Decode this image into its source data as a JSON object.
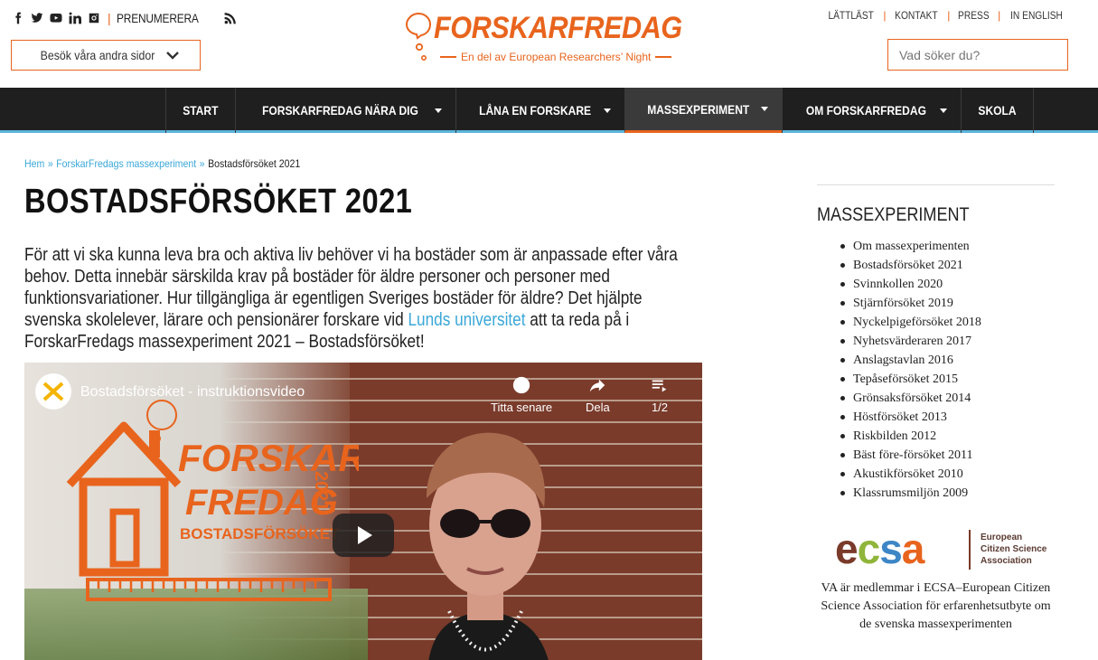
{
  "header": {
    "subscribe_label": "PRENUMERERA",
    "visit_label": "Besök våra andra sidor",
    "logo_word": "FORSKARFREDAG",
    "logo_tagline": "En del av European Researchers’ Night",
    "links": [
      "LÄTTLÄST",
      "KONTAKT",
      "PRESS",
      "IN ENGLISH"
    ],
    "search_placeholder": "Vad söker du?",
    "social_icons": [
      "facebook-icon",
      "twitter-icon",
      "youtube-icon",
      "linkedin-icon",
      "instagram-icon"
    ],
    "accent_color": "#e8641d"
  },
  "nav": {
    "items": [
      {
        "label": "START",
        "dropdown": false
      },
      {
        "label": "FORSKARFREDAG NÄRA DIG",
        "dropdown": true
      },
      {
        "label": "LÅNA EN FORSKARE",
        "dropdown": true
      },
      {
        "label": "MASSEXPERIMENT",
        "dropdown": true,
        "active": true
      },
      {
        "label": "OM FORSKARFREDAG",
        "dropdown": true
      },
      {
        "label": "SKOLA",
        "dropdown": false
      }
    ],
    "active_color": "#e8641d",
    "underline_color": "#5ab4dc"
  },
  "breadcrumb": {
    "home": "Hem",
    "sep": "»",
    "parent": "ForskarFredags massexperiment",
    "current": "Bostadsförsöket 2021"
  },
  "main": {
    "title": "BOSTADSFÖRSÖKET 2021",
    "intro_lines": [
      "För att vi ska kunna leva bra och aktiva liv behöver vi ha bostäder som är anpassade efter våra",
      "behov. Detta innebär särskilda krav på bostäder för äldre personer och personer med",
      "funktionsvariationer. Hur tillgängliga är egentligen Sveriges bostäder för äldre? Det hjälpte"
    ],
    "intro_line4_before": "svenska skolelever, lärare och pensionärer forskare vid ",
    "intro_link": "Lunds universitet",
    "intro_line4_after": " att ta reda på i",
    "intro_line5": "ForskarFredags massexperiment 2021 – Bostadsförsöket!"
  },
  "video": {
    "title": "Bostadsförsöket - instruktionsvideo",
    "watch_later": "Titta senare",
    "share": "Dela",
    "playlist": "1/2",
    "poster_line1": "FORSKAR",
    "poster_line2": "FREDAG",
    "poster_year": "2021",
    "poster_sub": "BOSTADSFÖRSÖKET"
  },
  "sidebar": {
    "heading": "MASSEXPERIMENT",
    "items": [
      "Om massexperimenten",
      "Bostadsförsöket 2021",
      "Svinnkollen 2020",
      "Stjärnförsöket 2019",
      "Nyckelpigeförsöket 2018",
      "Nyhetsvärderaren 2017",
      "Anslagstavlan 2016",
      "Tepåseförsöket 2015",
      "Grönsaksförsöket 2014",
      "Höstförsöket 2013",
      "Riskbilden 2012",
      "Bäst före-försöket 2011",
      "Akustikförsöket 2010",
      "Klassrumsmiljön 2009"
    ],
    "ecsa_logo_text": "ecsa",
    "ecsa_lines": [
      "European",
      "Citizen Science",
      "Association"
    ],
    "note": "VA är medlemmar i ECSA–European Citizen Science Association för erfarenhetsutbyte om de svenska massexperimenten"
  }
}
